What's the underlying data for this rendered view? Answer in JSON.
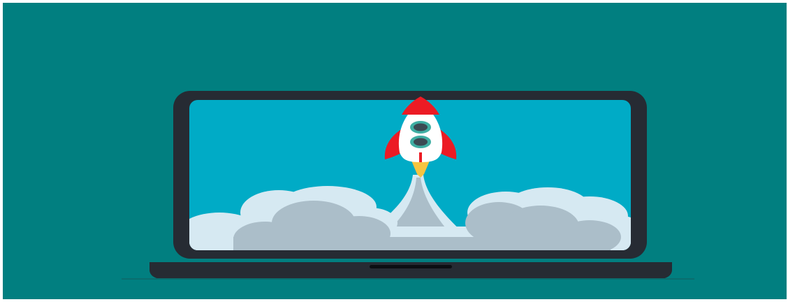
{
  "illustration": {
    "background_color": "#017f80",
    "laptop_frame_color": "#262b33",
    "screen_color": "#00abc6",
    "cloud_light_color": "#d6e9f2",
    "cloud_shadow_color": "#abbec9",
    "rocket_body_color": "#ffffff",
    "rocket_fin_color": "#ec1b24",
    "rocket_window_color": "#3b4a53",
    "rocket_window_ring_color": "#3faea3",
    "flame_color": "#f6c441",
    "icon": "rocket-launch-icon"
  }
}
